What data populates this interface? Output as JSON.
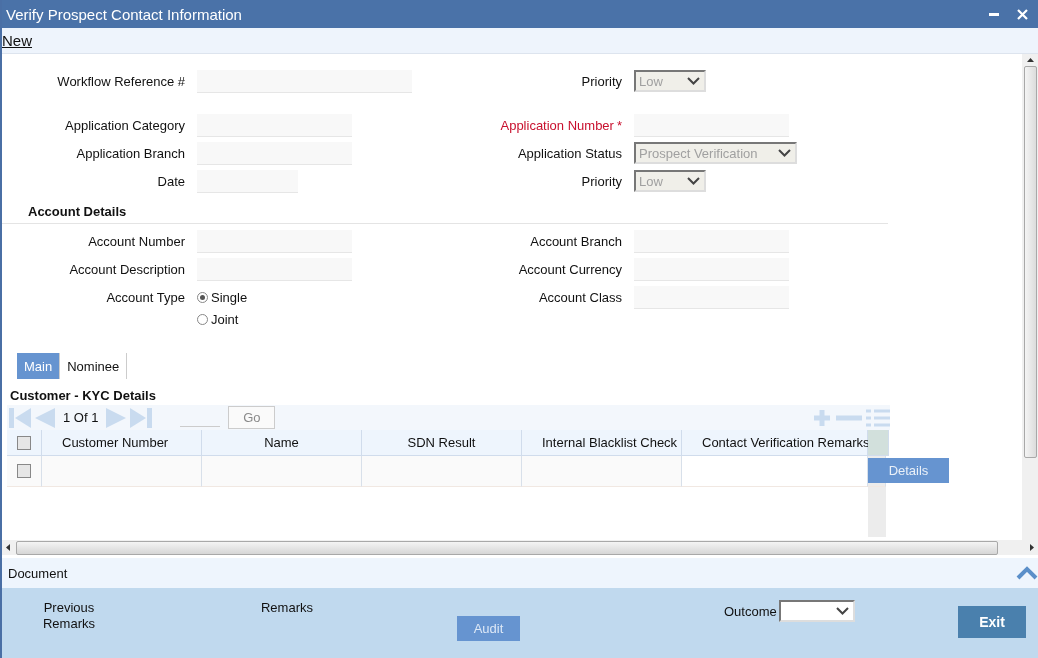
{
  "window": {
    "title": "Verify Prospect Contact Information"
  },
  "toolbar": {
    "items": [
      "New"
    ]
  },
  "header_rows": [
    {
      "left": {
        "label": "Workflow Reference #",
        "kind": "text"
      },
      "right": {
        "label": "Priority",
        "kind": "select",
        "value": "Low",
        "disabled": true
      }
    },
    {
      "left": {
        "label": "Application Category",
        "kind": "text"
      },
      "right": {
        "label": "Application Number",
        "kind": "text",
        "required_mark": "*"
      }
    },
    {
      "left": {
        "label": "Application Branch",
        "kind": "text"
      },
      "right": {
        "label": "Application Status",
        "kind": "select",
        "value": "Prospect Verification",
        "disabled": true
      }
    },
    {
      "left": {
        "label": "Date",
        "kind": "text"
      },
      "right": {
        "label": "Priority",
        "kind": "select",
        "value": "Low",
        "disabled": true
      }
    }
  ],
  "account_details": {
    "title": "Account Details",
    "rows": [
      {
        "left": {
          "label": "Account Number",
          "kind": "text"
        },
        "right": {
          "label": "Account Branch",
          "kind": "text"
        }
      },
      {
        "left": {
          "label": "Account Description",
          "kind": "text"
        },
        "right": {
          "label": "Account Currency",
          "kind": "text"
        }
      },
      {
        "left": {
          "label": "Account Type",
          "kind": "radio",
          "options": [
            {
              "label": "Single",
              "selected": true
            },
            {
              "label": "Joint",
              "selected": false
            }
          ]
        },
        "right": {
          "label": "Account Class",
          "kind": "text"
        }
      }
    ]
  },
  "tabs": [
    {
      "label": "Main",
      "selected": true
    },
    {
      "label": "Nominee",
      "selected": false
    }
  ],
  "kyc": {
    "title": "Customer - KYC Details",
    "pager": "1 Of 1",
    "go": {
      "label": "Go",
      "disabled": true
    },
    "header_checked": false,
    "columns": [
      "Customer Number",
      "Name",
      "SDN Result",
      "Internal Blacklist Check",
      "Contact Verification Remarks"
    ],
    "rows": [
      {
        "checked": false,
        "action": "Details"
      }
    ]
  },
  "document": {
    "label": "Document"
  },
  "footer": {
    "previous_remarks": "Previous Remarks",
    "remarks": "Remarks",
    "audit": "Audit",
    "outcome": {
      "label": "Outcome"
    },
    "exit": "Exit"
  }
}
